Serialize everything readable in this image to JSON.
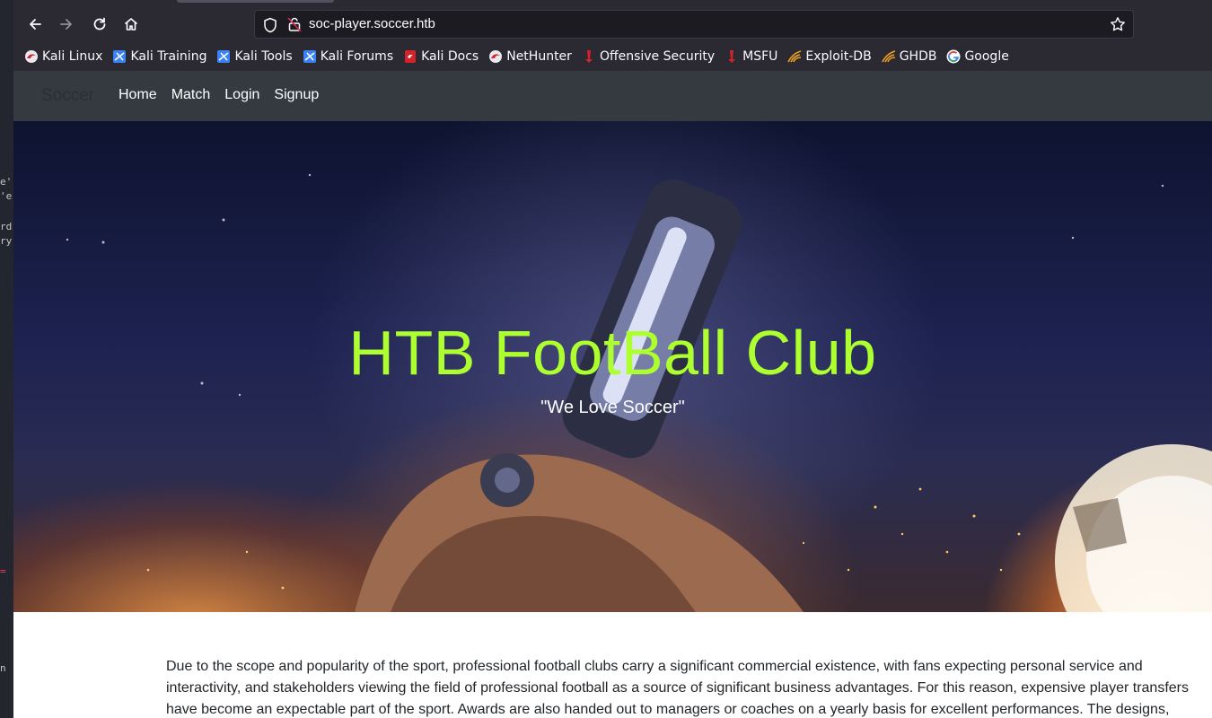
{
  "browser": {
    "url": "soc-player.soccer.htb",
    "bookmarks": [
      {
        "label": "Kali Linux",
        "icon": "kali-dragon-icon"
      },
      {
        "label": "Kali Training",
        "icon": "kali-training-icon"
      },
      {
        "label": "Kali Tools",
        "icon": "kali-tools-icon"
      },
      {
        "label": "Kali Forums",
        "icon": "kali-forums-icon"
      },
      {
        "label": "Kali Docs",
        "icon": "kali-docs-icon"
      },
      {
        "label": "NetHunter",
        "icon": "nethunter-icon"
      },
      {
        "label": "Offensive Security",
        "icon": "offsec-icon"
      },
      {
        "label": "MSFU",
        "icon": "msfu-icon"
      },
      {
        "label": "Exploit-DB",
        "icon": "exploit-db-icon"
      },
      {
        "label": "GHDB",
        "icon": "ghdb-icon"
      },
      {
        "label": "Google",
        "icon": "google-icon"
      }
    ]
  },
  "site": {
    "brand": "Soccer",
    "nav": [
      "Home",
      "Match",
      "Login",
      "Signup"
    ],
    "hero_title": "HTB FootBall Club",
    "hero_subtitle": "\"We Love Soccer\"",
    "paragraph": [
      "Due to the scope and popularity of the sport, professional football clubs carry a significant commercial existence, with fans expecting personal service and",
      "interactivity, and stakeholders viewing the field of professional football as a source of significant business advantages. For this reason, expensive player transfers",
      "have become an expectable part of the sport. Awards are also handed out to managers or coaches on a yearly basis for excellent performances. The designs,"
    ]
  },
  "colors": {
    "title_green": "#adff2f",
    "navbar_bg": "#343a40",
    "chrome_bg": "#2b2a33"
  }
}
